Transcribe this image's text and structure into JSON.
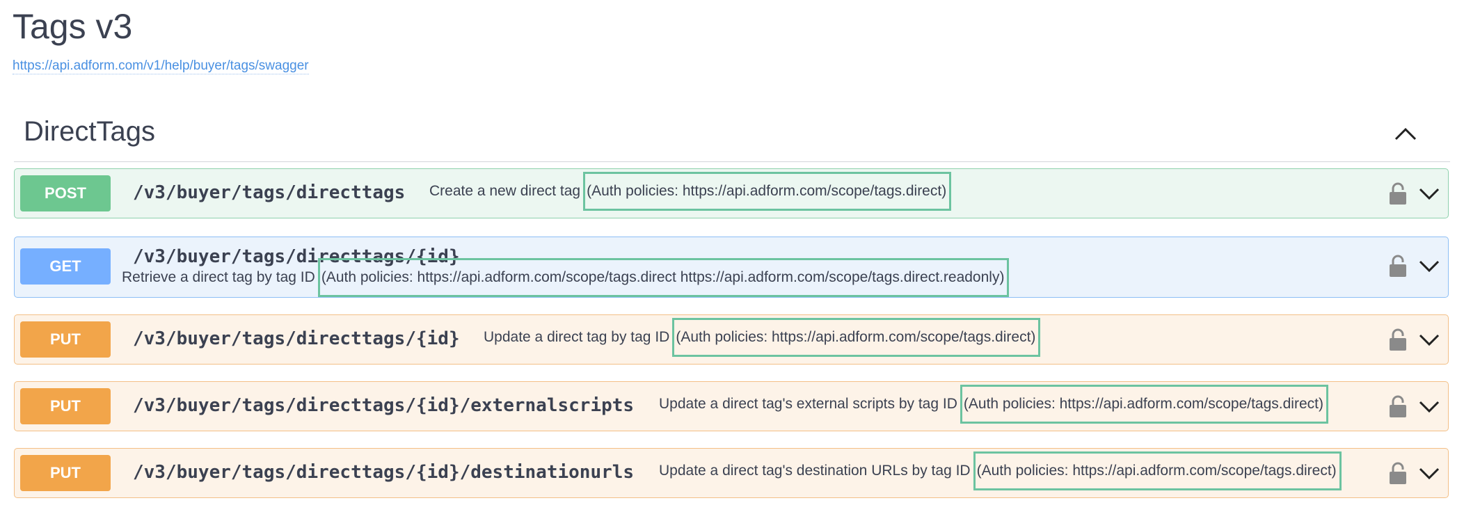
{
  "title": "Tags v3",
  "spec_url": "https://api.adform.com/v1/help/buyer/tags/swagger",
  "section": {
    "title": "DirectTags",
    "toggle_icon": "chevron-up-icon"
  },
  "operations": [
    {
      "method": "POST",
      "path": "/v3/buyer/tags/directtags",
      "summary": "Create a new direct tag",
      "auth": "(Auth policies: https://api.adform.com/scope/tags.direct)",
      "lock_icon": "lock-icon",
      "expand_icon": "chevron-down-icon"
    },
    {
      "method": "GET",
      "path": "/v3/buyer/tags/directtags/{id}",
      "summary": "Retrieve a direct tag by tag ID",
      "auth": "(Auth policies: https://api.adform.com/scope/tags.direct https://api.adform.com/scope/tags.direct.readonly)",
      "lock_icon": "lock-icon",
      "expand_icon": "chevron-down-icon"
    },
    {
      "method": "PUT",
      "path": "/v3/buyer/tags/directtags/{id}",
      "summary": "Update a direct tag by tag ID",
      "auth": "(Auth policies: https://api.adform.com/scope/tags.direct)",
      "lock_icon": "lock-icon",
      "expand_icon": "chevron-down-icon"
    },
    {
      "method": "PUT",
      "path": "/v3/buyer/tags/directtags/{id}/externalscripts",
      "summary": "Update a direct tag's external scripts by tag ID",
      "auth": "(Auth policies: https://api.adform.com/scope/tags.direct)",
      "lock_icon": "lock-icon",
      "expand_icon": "chevron-down-icon"
    },
    {
      "method": "PUT",
      "path": "/v3/buyer/tags/directtags/{id}/destinationurls",
      "summary": "Update a direct tag's destination URLs by tag ID",
      "auth": "(Auth policies: https://api.adform.com/scope/tags.direct)",
      "lock_icon": "lock-icon",
      "expand_icon": "chevron-down-icon"
    }
  ],
  "colors": {
    "post": "#6dc790",
    "get": "#76afff",
    "put": "#f2a54a",
    "auth_highlight": "#6cc3a0",
    "link": "#4990e2"
  }
}
